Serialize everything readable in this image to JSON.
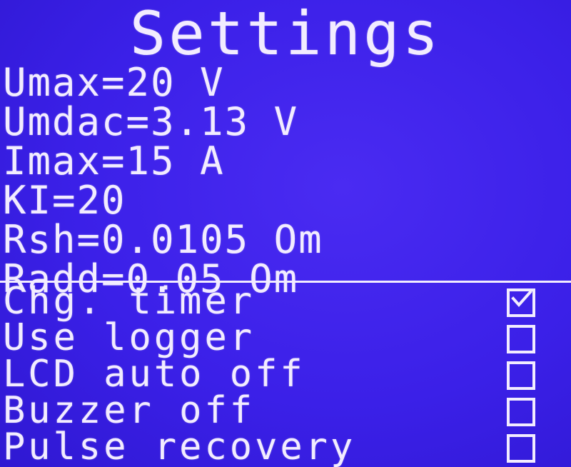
{
  "screen": {
    "title": "Settings",
    "params": [
      "Umax=20 V",
      "Umdac=3.13 V",
      "Imax=15 A",
      "KI=20",
      "Rsh=0.0105 Om",
      "Radd=0.05 Om"
    ],
    "options": [
      {
        "label": "Chg. timer",
        "checked": true
      },
      {
        "label": "Use logger",
        "checked": false
      },
      {
        "label": "LCD auto off",
        "checked": false
      },
      {
        "label": "Buzzer off",
        "checked": false
      },
      {
        "label": "Pulse recovery",
        "checked": false
      }
    ]
  },
  "colors": {
    "background": "#3b20e8",
    "foreground": "#f2ecff"
  }
}
